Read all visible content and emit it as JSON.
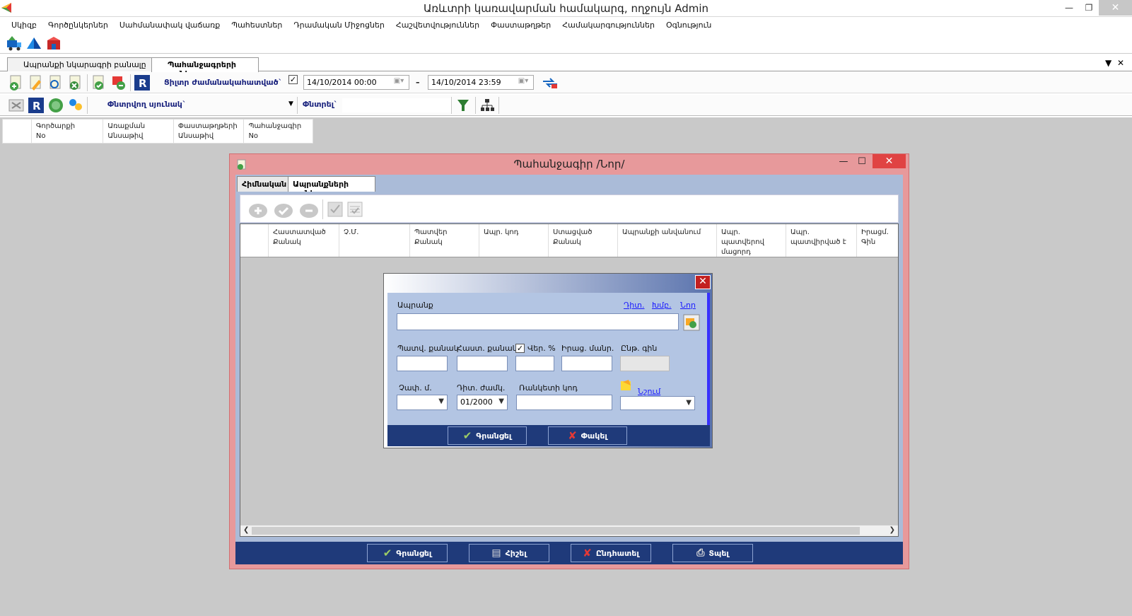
{
  "window": {
    "title": "Առևտրի կառավարման համակարգ, ողջույն Admin"
  },
  "menu": [
    "Սկիզբ",
    "Գործընկերներ",
    "Սահմանափակ վաճառք",
    "Պահեստներ",
    "Դրամական Միջոցներ",
    "Հաշվետվություններ",
    "Փաստաթղթեր",
    "Համակարգություններ",
    "Օգնություն"
  ],
  "doc_tabs": [
    "Ապրանքի նկարագրի բանալը ...",
    "Պահանջագրերի ցանկ"
  ],
  "toolbar1": {
    "period_label": "Ցիլտր ժամանակահատված`",
    "date_from": "14/10/2014 00:00",
    "dash": "–",
    "date_to": "14/10/2014 23:59"
  },
  "toolbar2": {
    "search_field_label": "Փնտրվող սյունակ`",
    "search_label": "Փնտրել`"
  },
  "info_grid": [
    {
      "line1": "Գործարքի",
      "line2": "No"
    },
    {
      "line1": "Առաքման",
      "line2": "Անսաթիվ"
    },
    {
      "line1": "Փաստաթղթերի",
      "line2": "Անսաթիվ"
    },
    {
      "line1": "Պահանջագիր",
      "line2": "No"
    }
  ],
  "order_window": {
    "title": "Պահանջագիր /Նոր/",
    "tabs": [
      "Հիմնական",
      "Ապրանքների ցանկ"
    ],
    "columns": [
      {
        "l1": "Հաստատված",
        "l2": "Քանակ",
        "w": 100
      },
      {
        "l1": "Չ.Մ.",
        "l2": "",
        "w": 100
      },
      {
        "l1": "Պատվեր",
        "l2": "Քանակ",
        "w": 98
      },
      {
        "l1": "Ապր. կոդ",
        "l2": "",
        "w": 98
      },
      {
        "l1": "Ստացված",
        "l2": "Քանակ",
        "w": 98
      },
      {
        "l1": "Ապրանքի անվանում",
        "l2": "",
        "w": 140
      },
      {
        "l1": "Ապր.",
        "l2": "պատվերով մացորդ",
        "w": 98
      },
      {
        "l1": "Ապր.",
        "l2": "պատվիրված է",
        "w": 100
      },
      {
        "l1": "Իրացմ.",
        "l2": "Գին",
        "w": 50
      }
    ],
    "buttons": [
      "Գրանցել",
      "Հիշել",
      "Ընդհատել",
      "Տպել"
    ]
  },
  "item_dialog": {
    "product_label": "Ապրանք",
    "links": [
      "Դիտ.",
      "Խմբ.",
      "Նոր"
    ],
    "qty_order_label": "Պատվ. քանակ",
    "qty_confirm_label": "Հաստ. քանակ",
    "markup_label": "Վեր. %",
    "sale_price_label": "Իրաց. մանր.",
    "cost_price_label": "Ընթ. գին",
    "unit_label": "Չափ. մ.",
    "period_label": "Դիտ. ժամկ.",
    "note_label": "Ռանկետի կոդ",
    "period_value": "01/2000",
    "new_link": "Նշում",
    "ok": "Գրանցել",
    "cancel": "Փակել"
  },
  "colors": {
    "accent": "#1f3a7a",
    "panel": "#b3c5e3",
    "order_frame": "#e7999b"
  }
}
